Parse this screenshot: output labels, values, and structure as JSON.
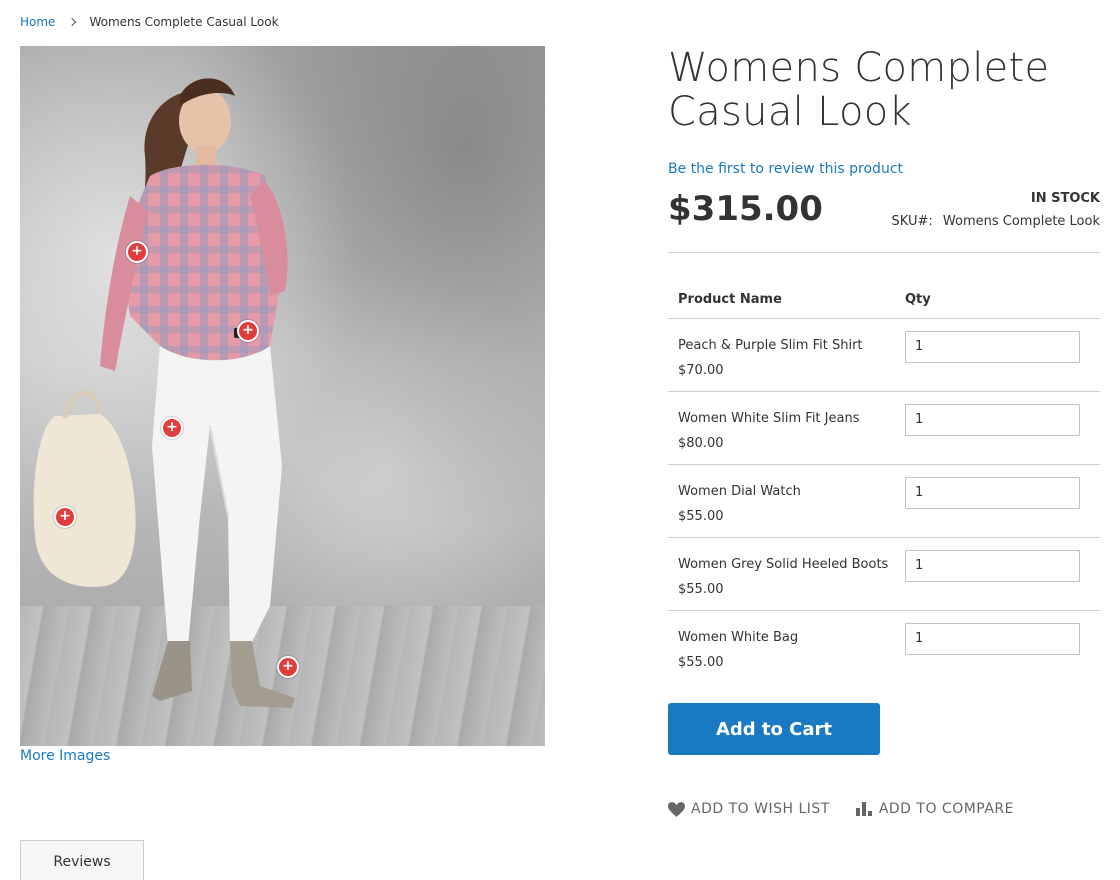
{
  "breadcrumb": {
    "home": "Home",
    "current": "Womens Complete Casual Look"
  },
  "gallery": {
    "more_images": "More Images",
    "hotspot_symbol": "+"
  },
  "product": {
    "title": "Womens Complete Casual Look",
    "review_link": "Be the first to review this product",
    "price": "$315.00",
    "stock": "IN STOCK",
    "sku_label": "SKU#:",
    "sku_value": "Womens Complete Look"
  },
  "grouped_table": {
    "col_name": "Product Name",
    "col_qty": "Qty",
    "items": [
      {
        "name": "Peach & Purple Slim Fit Shirt",
        "price": "$70.00",
        "qty": "1"
      },
      {
        "name": "Women White Slim Fit Jeans",
        "price": "$80.00",
        "qty": "1"
      },
      {
        "name": "Women Dial Watch",
        "price": "$55.00",
        "qty": "1"
      },
      {
        "name": "Women Grey Solid Heeled Boots",
        "price": "$55.00",
        "qty": "1"
      },
      {
        "name": "Women White Bag",
        "price": "$55.00",
        "qty": "1"
      }
    ]
  },
  "buttons": {
    "add_to_cart": "Add to Cart",
    "wishlist": "ADD TO WISH LIST",
    "compare": "ADD TO COMPARE"
  },
  "tabs": {
    "reviews": "Reviews"
  },
  "colors": {
    "link": "#1979c3",
    "primary_button": "#1979c3",
    "hotspot": "#e23c3c"
  },
  "icons": {
    "breadcrumb_separator": "chevron-right-icon",
    "wishlist": "heart-icon",
    "compare": "bar-chart-icon"
  }
}
